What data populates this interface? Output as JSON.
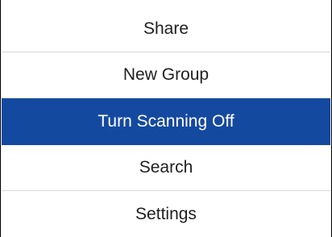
{
  "menu": {
    "items": [
      {
        "label": "Share",
        "selected": false
      },
      {
        "label": "New Group",
        "selected": false
      },
      {
        "label": "Turn Scanning Off",
        "selected": true
      },
      {
        "label": "Search",
        "selected": false
      },
      {
        "label": "Settings",
        "selected": false
      }
    ]
  },
  "colors": {
    "selected_background": "#1449a0",
    "selected_text": "#ffffff",
    "text": "#1f1f1f",
    "divider": "#d8d8d8",
    "border": "#000000"
  }
}
